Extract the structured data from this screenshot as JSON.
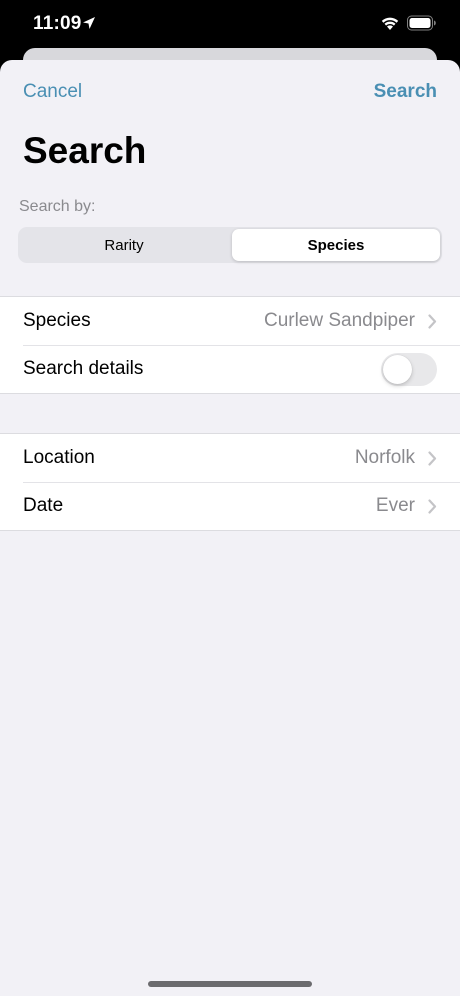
{
  "status_bar": {
    "time": "11:09",
    "icons": [
      "location-arrow-icon",
      "wifi-icon",
      "battery-icon"
    ]
  },
  "nav": {
    "cancel_label": "Cancel",
    "search_label": "Search",
    "accent_color": "#4a8fb3"
  },
  "title": "Search",
  "search_by": {
    "label": "Search by:",
    "segments": [
      {
        "label": "Rarity",
        "selected": false
      },
      {
        "label": "Species",
        "selected": true
      }
    ]
  },
  "group1": {
    "species": {
      "label": "Species",
      "value": "Curlew Sandpiper"
    },
    "search_details": {
      "label": "Search details",
      "toggle_on": false
    }
  },
  "group2": {
    "location": {
      "label": "Location",
      "value": "Norfolk"
    },
    "date": {
      "label": "Date",
      "value": "Ever"
    }
  }
}
